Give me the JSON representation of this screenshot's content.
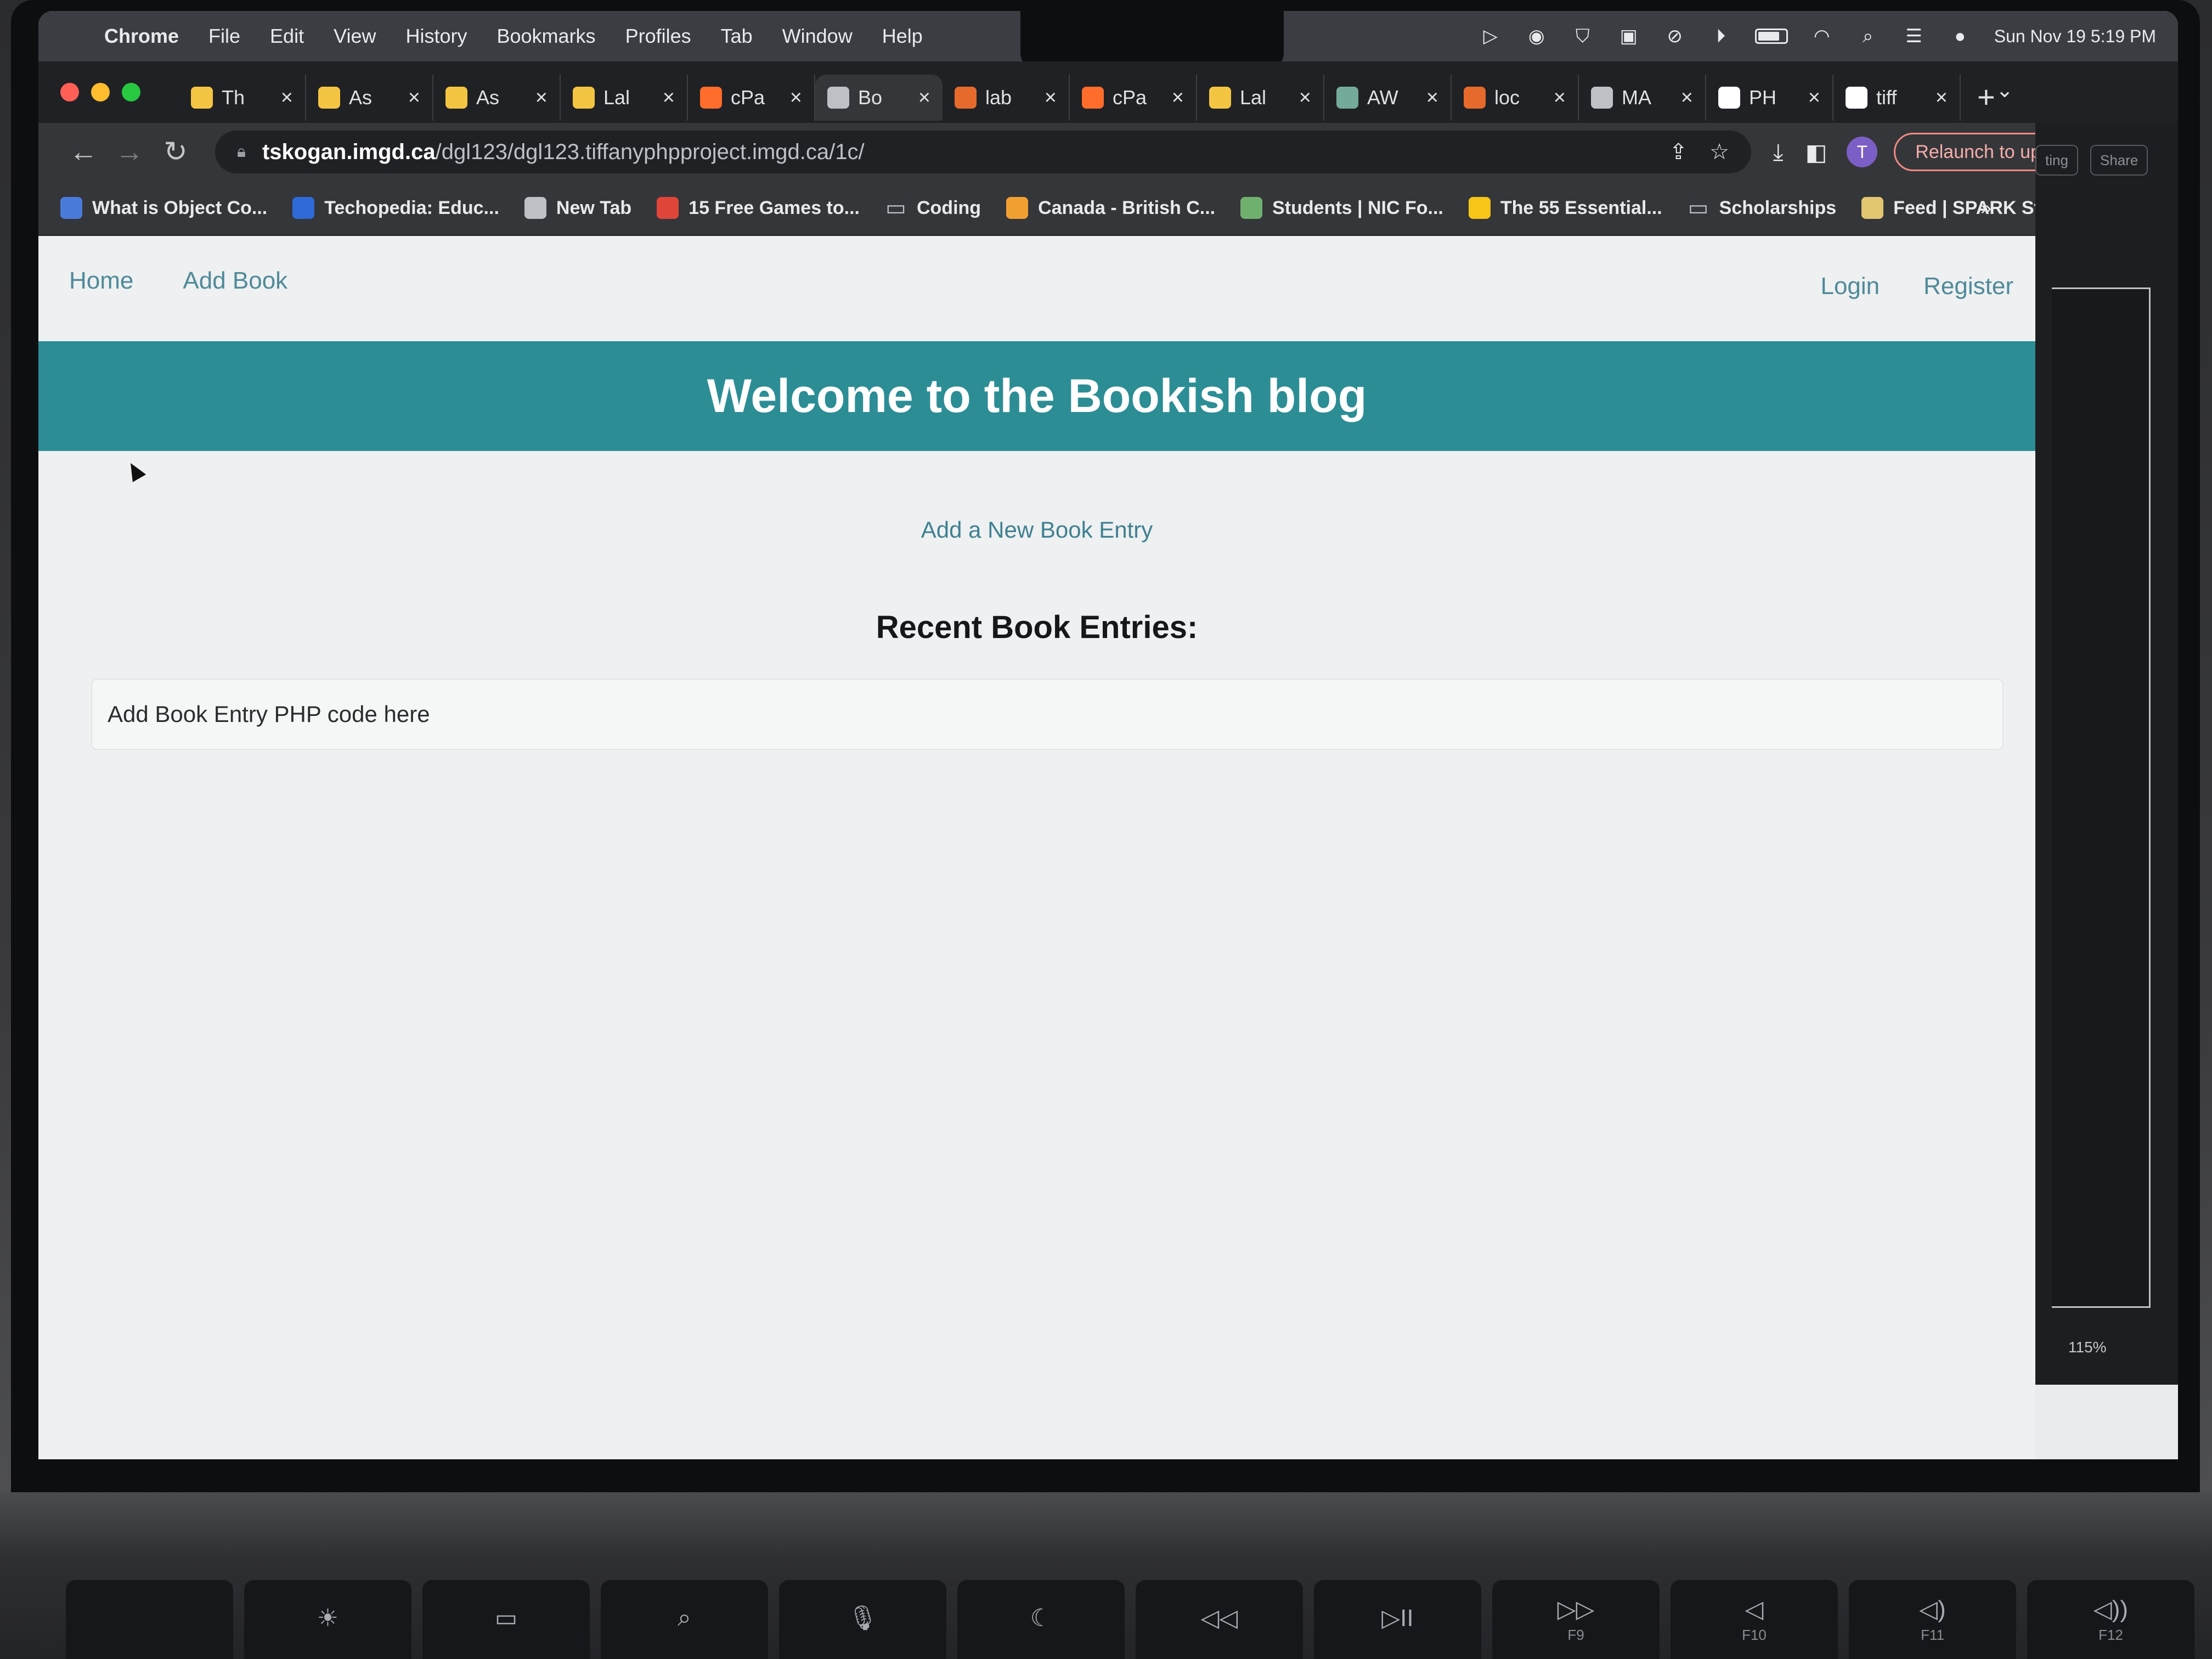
{
  "menubar": {
    "items": [
      "Chrome",
      "File",
      "Edit",
      "View",
      "History",
      "Bookmarks",
      "Profiles",
      "Tab",
      "Window",
      "Help"
    ],
    "datetime": "Sun Nov 19  5:19 PM"
  },
  "tabs": [
    {
      "label": "Th",
      "icon": "chart-icon",
      "color": "#f4c542"
    },
    {
      "label": "As",
      "icon": "chart-icon",
      "color": "#f4c542"
    },
    {
      "label": "As",
      "icon": "chart-icon",
      "color": "#f4c542"
    },
    {
      "label": "Lal",
      "icon": "chart-icon",
      "color": "#f4c542"
    },
    {
      "label": "cPa",
      "icon": "cpanel-icon",
      "color": "#ff6c2c"
    },
    {
      "label": "Bo",
      "icon": "globe-icon",
      "color": "#bdc1c6",
      "active": true
    },
    {
      "label": "lab",
      "icon": "brightspace-icon",
      "color": "#e66a2c"
    },
    {
      "label": "cPa",
      "icon": "cpanel-icon",
      "color": "#ff6c2c"
    },
    {
      "label": "Lal",
      "icon": "chart-icon",
      "color": "#f4c542"
    },
    {
      "label": "AW",
      "icon": "openai-icon",
      "color": "#74aa9c"
    },
    {
      "label": "loc",
      "icon": "brightspace-icon",
      "color": "#e66a2c"
    },
    {
      "label": "MA",
      "icon": "mamp-icon",
      "color": "#bdc1c6"
    },
    {
      "label": "PH",
      "icon": "github-icon",
      "color": "#ffffff"
    },
    {
      "label": "tiff",
      "icon": "github-icon",
      "color": "#ffffff"
    }
  ],
  "omnibox": {
    "host": "tskogan.imgd.ca",
    "path": "/dgl123/dgl123.tiffanyphpproject.imgd.ca/1c/"
  },
  "toolbar": {
    "avatar_letter": "T",
    "relaunch_label": "Relaunch to update"
  },
  "bookmarks": [
    {
      "label": "What is Object Co...",
      "icon": "bookmark-blue-icon",
      "color": "#4a7bdc"
    },
    {
      "label": "Techopedia: Educ...",
      "icon": "techopedia-icon",
      "color": "#2f6bd8"
    },
    {
      "label": "New Tab",
      "icon": "globe-icon",
      "color": "#bdc1c6"
    },
    {
      "label": "15 Free Games to...",
      "icon": "games-icon",
      "color": "#e0453a"
    },
    {
      "label": "Coding",
      "icon": "folder-icon",
      "color": "#bdc1c6"
    },
    {
      "label": "Canada - British C...",
      "icon": "canada-icon",
      "color": "#f0a030"
    },
    {
      "label": "Students | NIC Fo...",
      "icon": "loading-icon",
      "color": "#6fb06f"
    },
    {
      "label": "The 55 Essential...",
      "icon": "imdb-icon",
      "color": "#f5c518"
    },
    {
      "label": "Scholarships",
      "icon": "folder-icon",
      "color": "#bdc1c6"
    },
    {
      "label": "Feed | SPARK Stu...",
      "icon": "spark-icon",
      "color": "#e3c770"
    }
  ],
  "side_window": {
    "zoom": "115%",
    "button_a": "ting",
    "button_b": "Share"
  },
  "site": {
    "nav_left": [
      "Home",
      "Add Book"
    ],
    "nav_right": [
      "Login",
      "Register"
    ],
    "banner_title": "Welcome to the Bookish blog",
    "add_entry_link": "Add a New Book Entry",
    "recent_heading": "Recent Book Entries:",
    "entry_placeholder": "Add Book Entry PHP code here",
    "accent": "#2c8d95",
    "link_color": "#4f8a99"
  },
  "keyboard": {
    "keys": [
      {
        "glyph": "",
        "label": ""
      },
      {
        "glyph": "☀",
        "label": ""
      },
      {
        "glyph": "▭",
        "label": ""
      },
      {
        "glyph": "⌕",
        "label": ""
      },
      {
        "glyph": "🎙",
        "label": ""
      },
      {
        "glyph": "☾",
        "label": ""
      },
      {
        "glyph": "◁◁",
        "label": ""
      },
      {
        "glyph": "▷II",
        "label": ""
      },
      {
        "glyph": "▷▷",
        "label": "F9"
      },
      {
        "glyph": "◁",
        "label": "F10"
      },
      {
        "glyph": "◁)",
        "label": "F11"
      },
      {
        "glyph": "◁))",
        "label": "F12"
      }
    ]
  }
}
